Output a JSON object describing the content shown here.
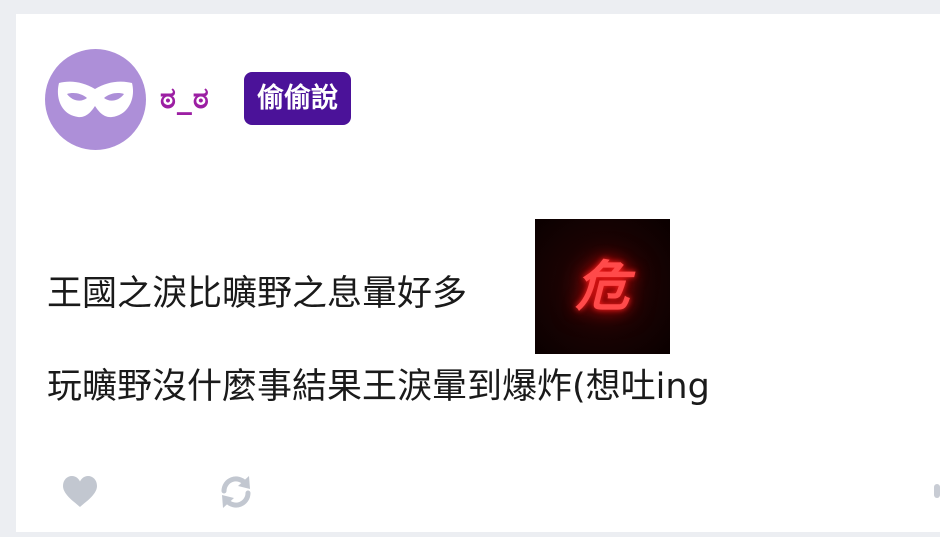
{
  "post": {
    "author": {
      "username": "ಠ_ಠ",
      "badge": "偷偷說",
      "avatar_icon": "mask-icon",
      "avatar_color": "#ad8fd8",
      "username_color": "#9c1fa3",
      "badge_color": "#4b1299"
    },
    "content": {
      "line1": "王國之淚比曠野之息暈好多",
      "sticker": {
        "text": "危",
        "icon": "danger-sticker"
      },
      "line2": "玩曠野沒什麼事結果王淚暈到爆炸(想吐ing"
    },
    "actions": {
      "like_icon": "heart-icon",
      "repost_icon": "refresh-icon",
      "icon_color": "#c2c7d0"
    }
  }
}
